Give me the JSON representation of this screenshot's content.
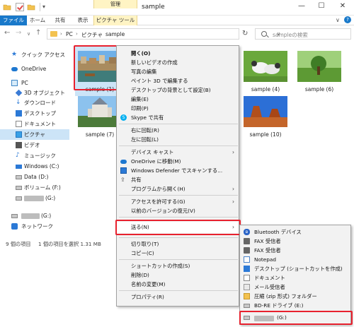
{
  "window": {
    "title": "sample",
    "context_tab_header": "管理",
    "controls": {
      "minimize": "—",
      "maximize": "☐",
      "close": "✕"
    },
    "quick_access": {
      "dropdown": "▾"
    }
  },
  "ribbon": {
    "tabs": [
      {
        "label": "ファイル"
      },
      {
        "label": "ホーム"
      },
      {
        "label": "共有"
      },
      {
        "label": "表示"
      },
      {
        "label": "ピクチャ ツール"
      }
    ],
    "expand": "∨",
    "help": "?"
  },
  "address": {
    "back": "←",
    "forward": "→",
    "recent": "∨",
    "up": "↑",
    "crumbs": [
      "PC",
      "ピクチャ",
      "sample"
    ],
    "separator": "›",
    "dropdown": "∨",
    "refresh": "↻",
    "search_placeholder": "sampleの検索"
  },
  "sidebar": {
    "items": [
      {
        "label": "クイック アクセス",
        "icon": "star-icon"
      },
      {
        "label": "OneDrive",
        "icon": "cloud-icon"
      },
      {
        "label": "PC",
        "icon": "pc-icon"
      },
      {
        "label": "3D オブジェクト",
        "icon": "cube-icon"
      },
      {
        "label": "ダウンロード",
        "icon": "download-icon"
      },
      {
        "label": "デスクトップ",
        "icon": "desktop-icon"
      },
      {
        "label": "ドキュメント",
        "icon": "document-icon"
      },
      {
        "label": "ピクチャ",
        "icon": "pictures-icon"
      },
      {
        "label": "ビデオ",
        "icon": "video-icon"
      },
      {
        "label": "ミュージック",
        "icon": "music-icon"
      },
      {
        "label": "Windows (C:)",
        "icon": "windows-drive-icon"
      },
      {
        "label": "Data (D:)",
        "icon": "drive-icon"
      },
      {
        "label": "ボリューム (F:)",
        "icon": "drive-icon"
      },
      {
        "label": "(G:)",
        "icon": "drive-icon"
      },
      {
        "label": "(G:)",
        "icon": "drive-icon"
      },
      {
        "label": "ネットワーク",
        "icon": "network-icon"
      }
    ],
    "glyphs": {
      "star": "★",
      "download": "↓",
      "music": "♪"
    }
  },
  "files": [
    {
      "label": "sample (1)"
    },
    {
      "label": "sample (4)"
    },
    {
      "label": "sample (6)"
    },
    {
      "label": "sample (7)"
    },
    {
      "label": "sample (10)"
    }
  ],
  "status": {
    "count": "9 個の項目",
    "selection": "1 個の項目を選択  1.31 MB"
  },
  "context_menu": {
    "items": [
      {
        "label": "開く(O)"
      },
      {
        "label": "新しいビデオの作成"
      },
      {
        "label": "写真の編集"
      },
      {
        "label": "ペイント 3D で編集する"
      },
      {
        "label": "デスクトップの背景として設定(B)"
      },
      {
        "label": "編集(E)"
      },
      {
        "label": "印刷(P)"
      },
      {
        "label": "Skype で共有"
      },
      {
        "label": "右に回転(R)"
      },
      {
        "label": "左に回転(L)"
      },
      {
        "label": "デバイス キャスト"
      },
      {
        "label": "OneDrive に移動(M)"
      },
      {
        "label": "Windows Defender でスキャンする..."
      },
      {
        "label": "共有"
      },
      {
        "label": "プログラムから開く(H)"
      },
      {
        "label": "アクセスを許可する(G)"
      },
      {
        "label": "以前のバージョンの復元(V)"
      },
      {
        "label": "送る(N)"
      },
      {
        "label": "切り取り(T)"
      },
      {
        "label": "コピー(C)"
      },
      {
        "label": "ショートカットの作成(S)"
      },
      {
        "label": "削除(D)"
      },
      {
        "label": "名前の変更(M)"
      },
      {
        "label": "プロパティ(R)"
      }
    ],
    "submenu_arrow": "›",
    "glyphs": {
      "skype": "S",
      "share": "⇪"
    }
  },
  "send_to_menu": {
    "items": [
      {
        "label": "Bluetooth デバイス"
      },
      {
        "label": "FAX 受信者"
      },
      {
        "label": "FAX 受信者"
      },
      {
        "label": "Notepad"
      },
      {
        "label": "デスクトップ (ショートカットを作成)"
      },
      {
        "label": "ドキュメント"
      },
      {
        "label": "メール受信者"
      },
      {
        "label": "圧縮 (zip 形式) フォルダー"
      },
      {
        "label": "BD-RE ドライブ (E:)"
      },
      {
        "label": "(G:)"
      }
    ],
    "glyphs": {
      "bluetooth": "ʙ"
    }
  },
  "colors": {
    "accent": "#1979ca",
    "selection": "#cce4f7",
    "highlight_frame": "#e8212e",
    "context_tab": "#fff4c4"
  }
}
